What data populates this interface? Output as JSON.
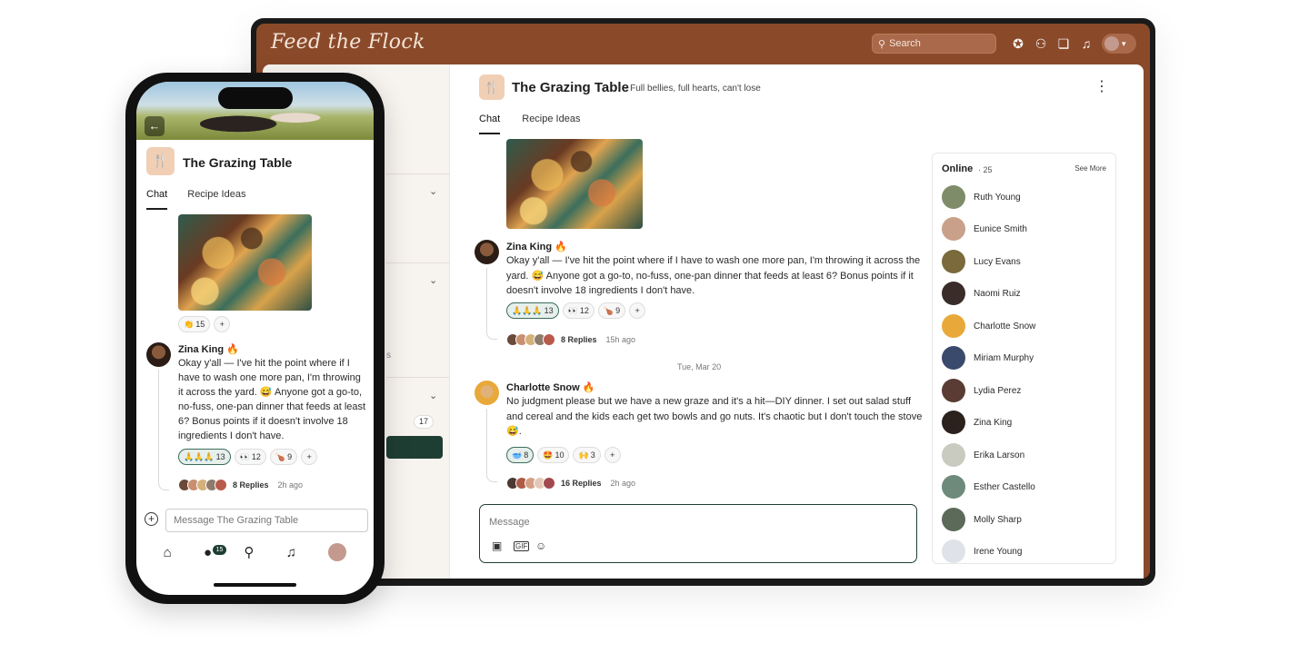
{
  "colors": {
    "brand_brown": "#8a4a2a",
    "accent_green": "#1f3e33",
    "channel_icon_bg": "#f1cfb5"
  },
  "desktop": {
    "brand": "Feed the Flock",
    "search_placeholder": "Search",
    "topbar_icons": [
      "star-circle-icon",
      "add-user-icon",
      "chat-bubbles-icon",
      "bell-icon"
    ],
    "sidebar": {
      "unread_count": "17"
    },
    "channel": {
      "icon": "fork-knife-icon",
      "title": "The Grazing Table",
      "separator": "·",
      "subtitle": "Full bellies, full hearts, can't lose",
      "tabs": [
        "Chat",
        "Recipe Ideas"
      ]
    },
    "messages": [
      {
        "author": "Zina King",
        "badge": "🔥",
        "text": "Okay y'all — I've hit the point where if I have to wash one more pan, I'm throwing it across the yard. 😅 Anyone got a go-to, no-fuss, one-pan dinner that feeds at least 6? Bonus points if it doesn't involve 18 ingredients I don't have.",
        "reactions": [
          {
            "emoji": "🙏🙏🙏",
            "count": "13"
          },
          {
            "emoji": "👀",
            "count": "12"
          },
          {
            "emoji": "🍗",
            "count": "9"
          }
        ],
        "replies": "8 Replies",
        "time": "15h ago"
      },
      {
        "author": "Charlotte Snow",
        "badge": "🔥",
        "text": "No judgment please but we have a new graze and it's a hit—DIY dinner. I set out salad stuff and cereal and the kids each get two bowls and go nuts. It's chaotic but I don't touch the stove 😅.",
        "reactions": [
          {
            "emoji": "🥣",
            "count": "8"
          },
          {
            "emoji": "🤩",
            "count": "10"
          },
          {
            "emoji": "🙌",
            "count": "3"
          }
        ],
        "replies": "16 Replies",
        "time": "2h ago"
      }
    ],
    "date_divider": "Tue, Mar 20",
    "composer_placeholder": "Message",
    "composer_tools": [
      "image-icon",
      "gif-icon",
      "emoji-icon"
    ],
    "online": {
      "title": "Online",
      "separator": "·",
      "count": "25",
      "see_more": "See More",
      "people": [
        "Ruth Young",
        "Eunice Smith",
        "Lucy Evans",
        "Naomi Ruiz",
        "Charlotte Snow",
        "Miriam Murphy",
        "Lydia Perez",
        "Zina King",
        "Erika Larson",
        "Esther Castello",
        "Molly Sharp",
        "Irene Young"
      ]
    }
  },
  "phone": {
    "channel_title": "The Grazing Table",
    "tabs": [
      "Chat",
      "Recipe Ideas"
    ],
    "image_reaction": {
      "emoji": "👏",
      "count": "15"
    },
    "message": {
      "author": "Zina King",
      "badge": "🔥",
      "text": "Okay y'all — I've hit the point where if I have to wash one more pan, I'm throwing it across the yard. 😅 Anyone got a go-to, no-fuss, one-pan dinner that feeds at least 6? Bonus points if it doesn't involve 18 ingredients I don't have.",
      "reactions": [
        {
          "emoji": "🙏🙏🙏",
          "count": "13"
        },
        {
          "emoji": "👀",
          "count": "12"
        },
        {
          "emoji": "🍗",
          "count": "9"
        }
      ],
      "replies": "8 Replies",
      "time": "2h ago"
    },
    "composer_placeholder": "Message The Grazing Table",
    "nav_badge": "15",
    "nav_icons": [
      "home-icon",
      "chat-icon",
      "search-icon",
      "bell-icon",
      "profile-avatar"
    ]
  }
}
